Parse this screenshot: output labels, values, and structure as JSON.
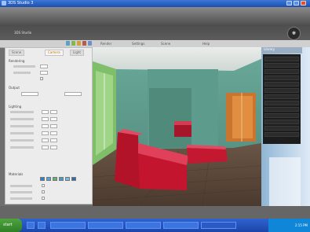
{
  "window": {
    "title": "3DS Studio 3"
  },
  "header": {
    "brand": "3DS Studio"
  },
  "toolbar": {
    "labels": [
      "Render",
      "Settings",
      "Scene",
      "Help"
    ]
  },
  "left_panel": {
    "tabs": [
      "Scene",
      "Camera",
      "Light"
    ],
    "sections": [
      "Rendering",
      "Output",
      "Lighting",
      "Materials"
    ]
  },
  "right_panel": {
    "title": "Library"
  },
  "taskbar": {
    "start_label": "start",
    "clock": "2:15 PM"
  },
  "colors": {
    "title_bar": "#2a5fc4",
    "sofa": "#c3162e",
    "wall": "#5c9a8c",
    "floor": "#5e4a3c"
  }
}
